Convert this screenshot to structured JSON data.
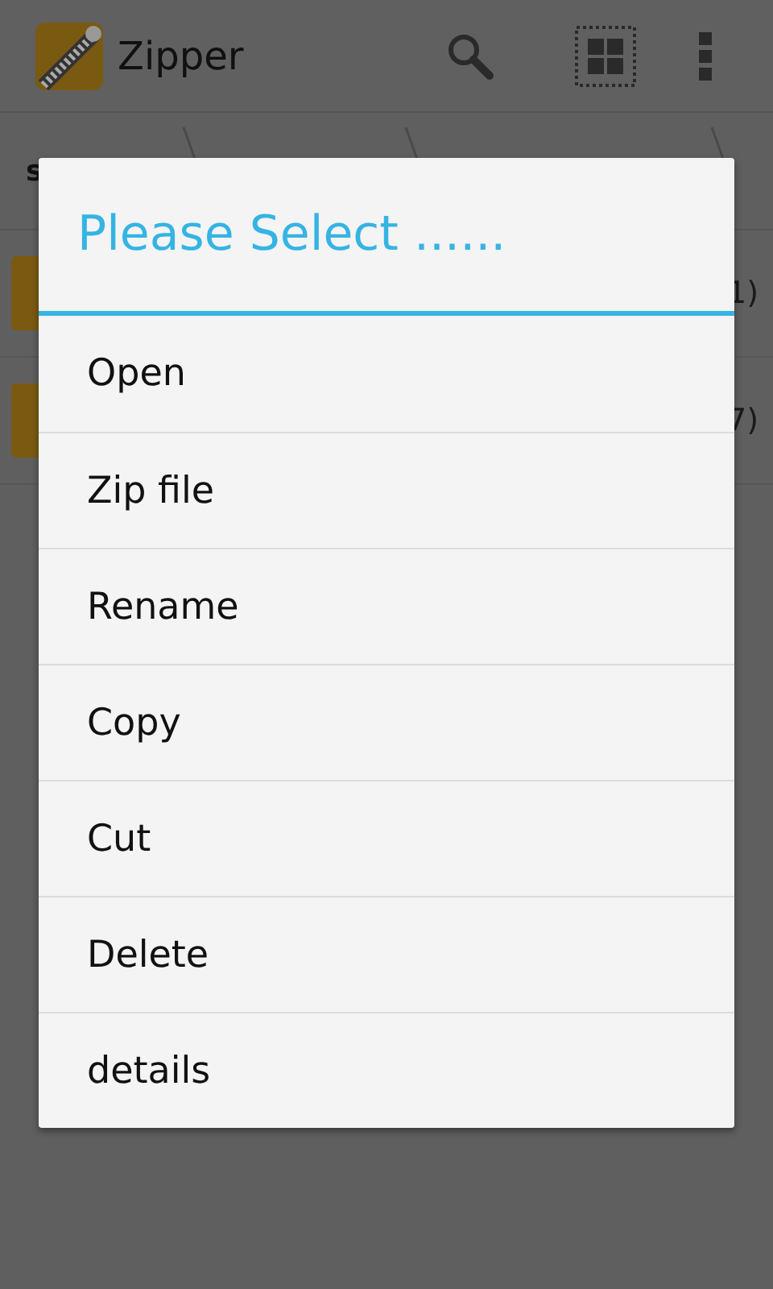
{
  "app_bar": {
    "title": "Zipper"
  },
  "breadcrumb": {
    "items": [
      "s"
    ]
  },
  "files": [
    {
      "count": "1)"
    },
    {
      "count": "7)"
    }
  ],
  "dialog": {
    "title": "Please Select ......",
    "items": [
      "Open",
      "Zip file",
      "Rename",
      "Copy",
      "Cut",
      "Delete",
      "details"
    ]
  }
}
